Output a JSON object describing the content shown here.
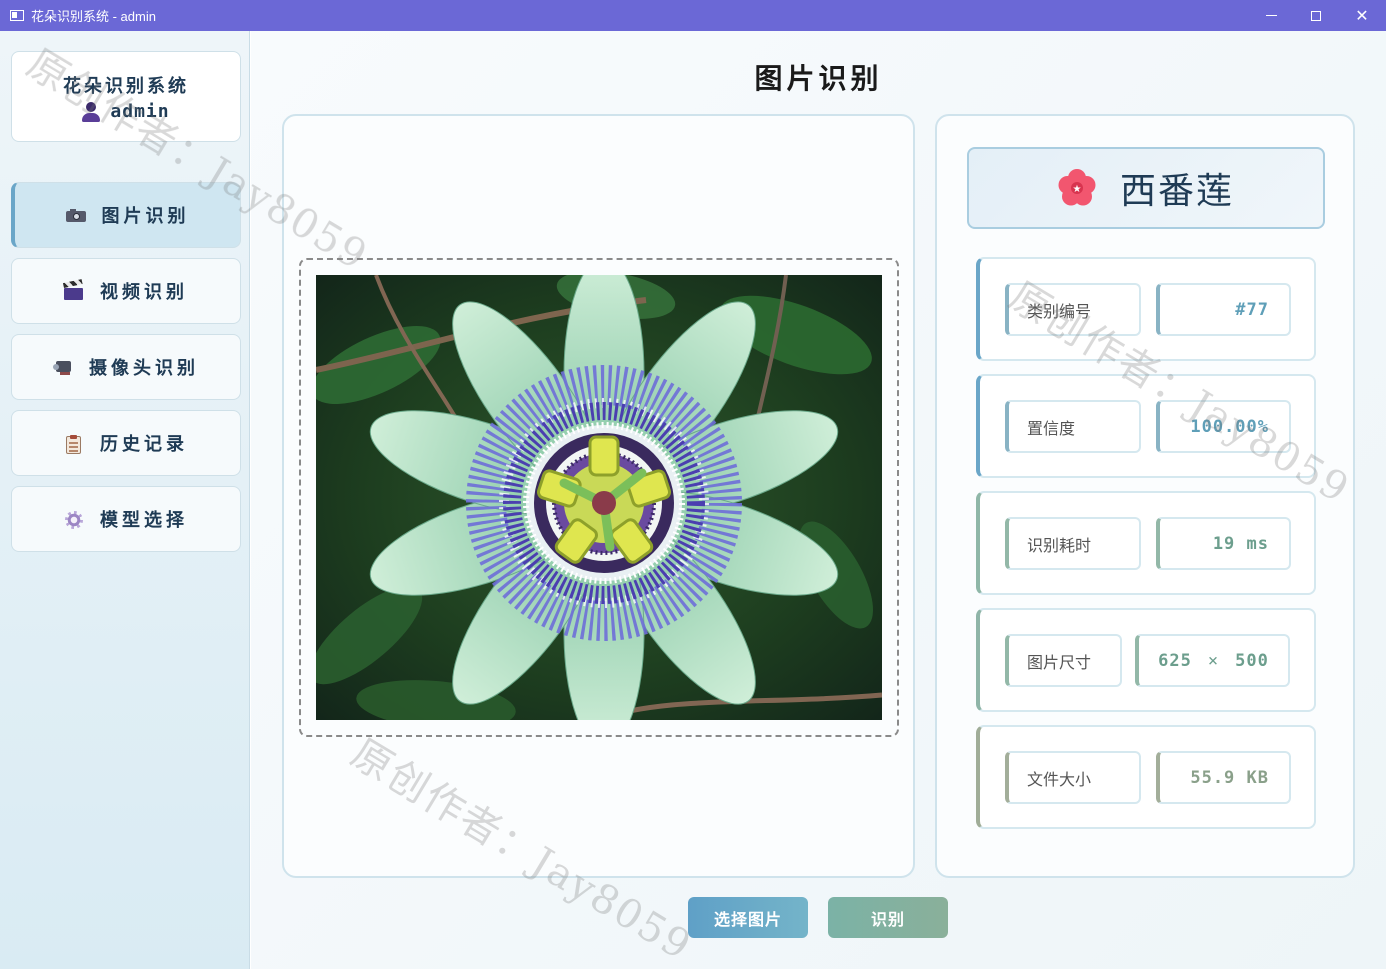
{
  "window": {
    "title": "花朵识别系统 - admin",
    "controls": {
      "minimize_icon": "minimize-icon",
      "maximize_icon": "maximize-icon",
      "close_icon": "close-icon"
    },
    "titlebar_color": "#6b68d6"
  },
  "sidebar": {
    "system_name": "花朵识别系统",
    "username": "admin",
    "items": [
      {
        "label": "图片识别",
        "icon": "camera-icon",
        "active": true
      },
      {
        "label": "视频识别",
        "icon": "clapper-icon",
        "active": false
      },
      {
        "label": "摄像头识别",
        "icon": "webcam-icon",
        "active": false
      },
      {
        "label": "历史记录",
        "icon": "clipboard-icon",
        "active": false
      },
      {
        "label": "模型选择",
        "icon": "gear-icon",
        "active": false
      }
    ]
  },
  "main": {
    "page_title": "图片识别",
    "result": {
      "flower_name": "西番莲",
      "name_icon": "blossom-icon",
      "rows": [
        {
          "label": "类别编号",
          "value": "#77"
        },
        {
          "label": "置信度",
          "value": "100.00%"
        },
        {
          "label": "识别耗时",
          "value": "19 ms"
        },
        {
          "label": "图片尺寸",
          "width": "625",
          "times": "×",
          "height": "500"
        },
        {
          "label": "文件大小",
          "value": "55.9 KB"
        }
      ]
    },
    "buttons": {
      "select_image": "选择图片",
      "recognize": "识别"
    }
  },
  "watermark": "原创作者：Jay8059",
  "colors": {
    "accent_blue": "#5fa0c7",
    "accent_green": "#7bb2a6",
    "text_dark": "#1f3b55"
  }
}
